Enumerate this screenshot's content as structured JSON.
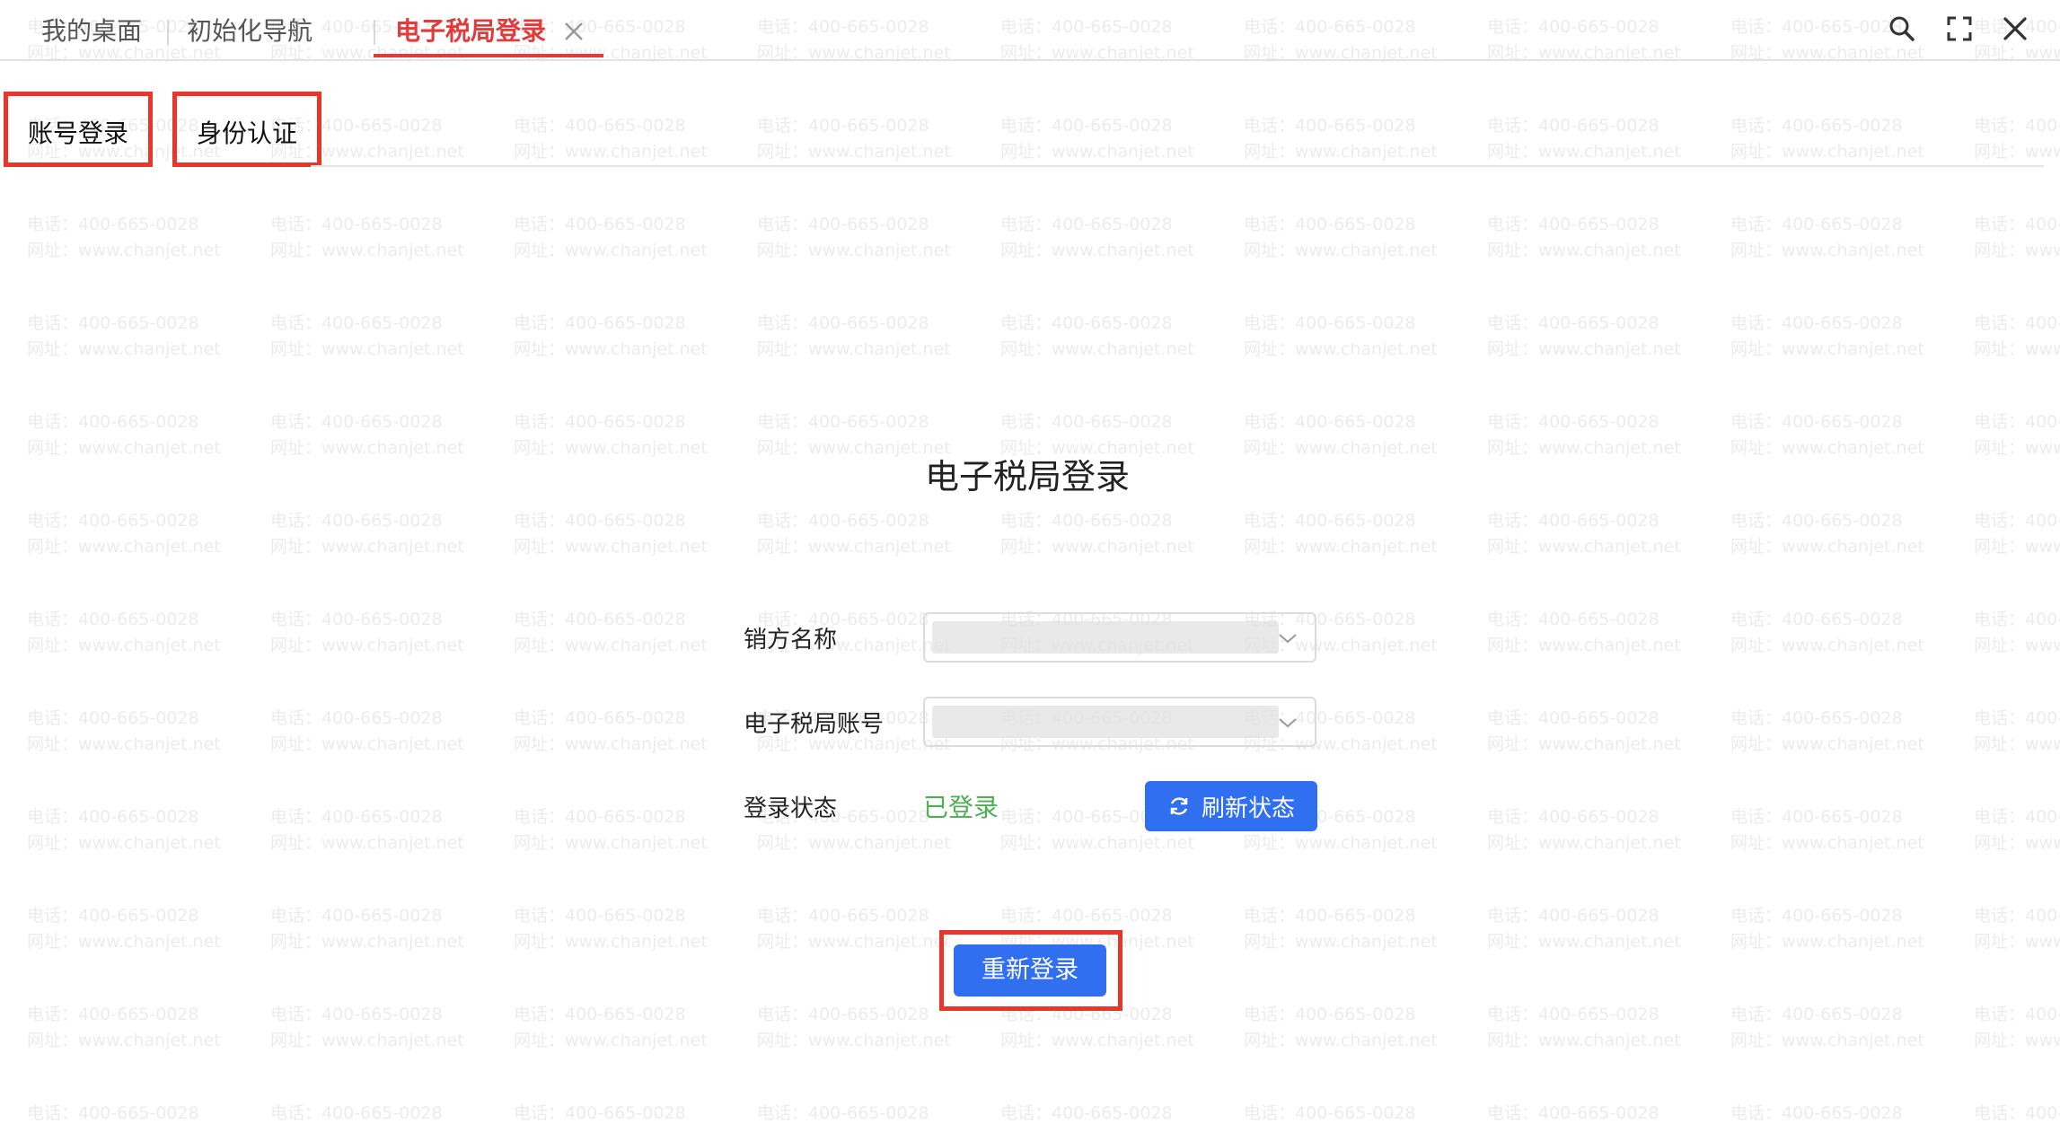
{
  "watermark": {
    "phone": "电话：400-665-0028",
    "site": "网址：www.chanjet.net"
  },
  "tabs": [
    {
      "label": "我的桌面"
    },
    {
      "label": "初始化导航"
    },
    {
      "label": "电子税局登录",
      "active": true
    }
  ],
  "toolbar_icons": [
    "search-icon",
    "fullscreen-icon",
    "close-icon"
  ],
  "subtabs": [
    {
      "label": "账号登录"
    },
    {
      "label": "身份认证"
    }
  ],
  "form": {
    "title": "电子税局登录",
    "seller_label": "销方名称",
    "account_label": "电子税局账号",
    "status_label": "登录状态",
    "status_value": "已登录",
    "refresh_label": "刷新状态",
    "relogin_label": "重新登录"
  },
  "colors": {
    "accent_red": "#e03c3c",
    "primary_blue": "#2f6ff0",
    "status_green": "#4caf50"
  }
}
